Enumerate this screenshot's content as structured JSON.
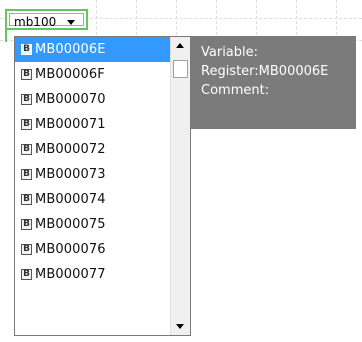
{
  "combo": {
    "value": "mb100"
  },
  "list": {
    "items": [
      {
        "icon": "B",
        "label": "MB00006E",
        "selected": true
      },
      {
        "icon": "B",
        "label": "MB00006F",
        "selected": false
      },
      {
        "icon": "B",
        "label": "MB000070",
        "selected": false
      },
      {
        "icon": "B",
        "label": "MB000071",
        "selected": false
      },
      {
        "icon": "B",
        "label": "MB000072",
        "selected": false
      },
      {
        "icon": "B",
        "label": "MB000073",
        "selected": false
      },
      {
        "icon": "B",
        "label": "MB000074",
        "selected": false
      },
      {
        "icon": "B",
        "label": "MB000075",
        "selected": false
      },
      {
        "icon": "B",
        "label": "MB000076",
        "selected": false
      },
      {
        "icon": "B",
        "label": "MB000077",
        "selected": false
      }
    ]
  },
  "tooltip": {
    "variable": "Variable:",
    "register": "Register:MB00006E",
    "comment": "Comment:"
  },
  "colors": {
    "selection": "#3399ff",
    "combo_border": "#5fc85f",
    "tooltip_bg": "#7b7b7b"
  }
}
